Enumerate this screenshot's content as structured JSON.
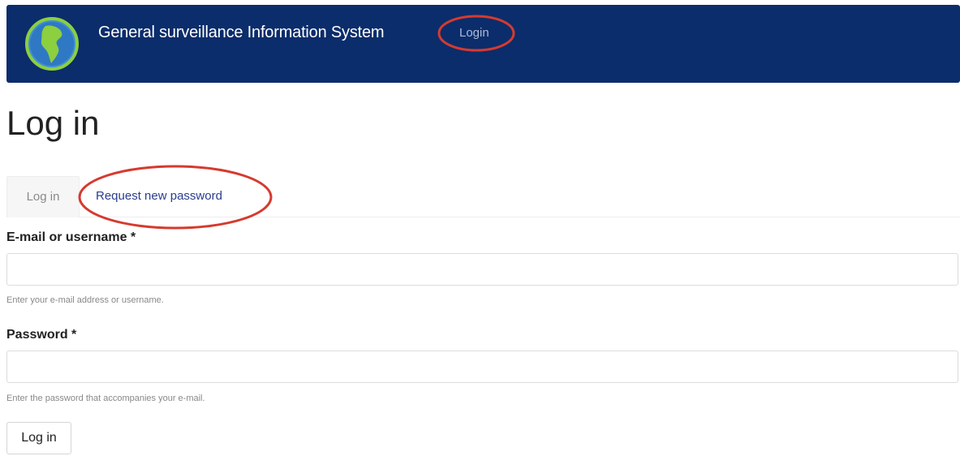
{
  "header": {
    "site_name": "General surveillance Information System",
    "nav_login": "Login",
    "navbar_color": "#0b2d6b",
    "annotation_color": "#d63a2f",
    "logo_icon": "globe-americas-icon"
  },
  "page": {
    "title": "Log in"
  },
  "tabs": [
    {
      "label": "Log in",
      "active": true
    },
    {
      "label": "Request new password",
      "active": false
    }
  ],
  "form": {
    "username": {
      "label": "E-mail or username *",
      "value": "",
      "help": "Enter your e-mail address or username."
    },
    "password": {
      "label": "Password *",
      "value": "",
      "help": "Enter the password that accompanies your e-mail."
    },
    "submit_label": "Log in"
  }
}
